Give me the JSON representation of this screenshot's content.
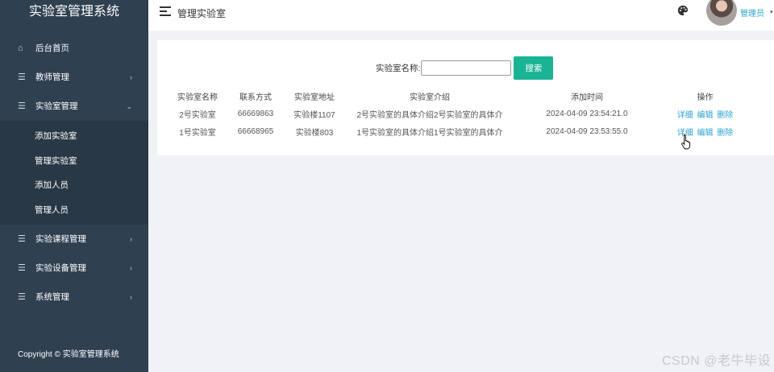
{
  "sidebar": {
    "brand": "实验室管理系统",
    "items": [
      {
        "label": "后台首页",
        "icon": "home-icon"
      },
      {
        "label": "教师管理",
        "icon": "list-icon",
        "arrow": "›"
      },
      {
        "label": "实验室管理",
        "icon": "list-icon",
        "arrow": "⌄"
      },
      {
        "label": "实验课程管理",
        "icon": "list-icon",
        "arrow": "›"
      },
      {
        "label": "实验设备管理",
        "icon": "list-icon",
        "arrow": "›"
      },
      {
        "label": "系统管理",
        "icon": "list-icon",
        "arrow": "›"
      }
    ],
    "sub_items": [
      "添加实验室",
      "管理实验室",
      "添加人员",
      "管理人员"
    ],
    "footer": "Copyright © 实验室管理系统"
  },
  "header": {
    "breadcrumb": "管理实验室",
    "user_name": "管理员",
    "caret": "▾"
  },
  "search": {
    "label": "实验室名称:",
    "value": "",
    "button": "搜索"
  },
  "table": {
    "headers": [
      "实验室名称",
      "联系方式",
      "实验室地址",
      "实验室介绍",
      "添加时间",
      "操作"
    ],
    "rows": [
      {
        "name": "2号实验室",
        "phone": "66669863",
        "address": "实验楼1107",
        "intro": "2号实验室的具体介绍2号实验室的具体介",
        "time": "2024-04-09 23:54:21.0"
      },
      {
        "name": "1号实验室",
        "phone": "66668965",
        "address": "实验楼803",
        "intro": "1号实验室的具体介绍1号实验室的具体介",
        "time": "2024-04-09 23:53:55.0"
      }
    ],
    "actions": {
      "detail": "详细",
      "edit": "编辑",
      "delete": "删除"
    }
  },
  "watermark": "CSDN @老牛毕设",
  "colors": {
    "sidebar": "#2f4050",
    "accent": "#1ab394",
    "link": "#2aa3cf"
  }
}
